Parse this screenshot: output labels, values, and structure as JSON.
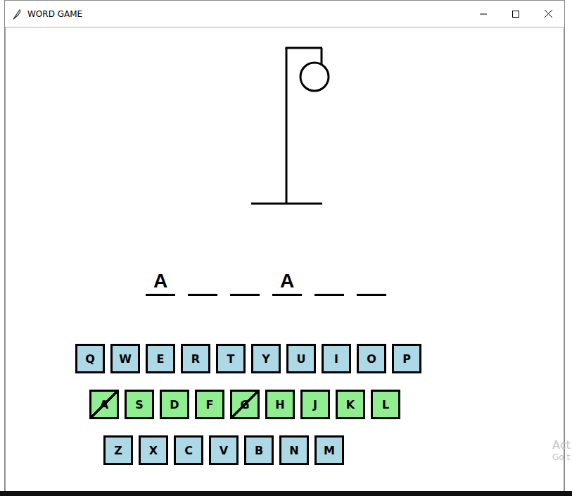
{
  "window": {
    "title": "WORD GAME"
  },
  "gallows": {
    "wrong_guesses": 1
  },
  "word": {
    "slots": [
      "A",
      "",
      "",
      "A",
      "",
      ""
    ]
  },
  "keyboard": {
    "rows": [
      {
        "color": "#add8e6",
        "keys": [
          {
            "label": "Q",
            "used": false
          },
          {
            "label": "W",
            "used": false
          },
          {
            "label": "E",
            "used": false
          },
          {
            "label": "R",
            "used": false
          },
          {
            "label": "T",
            "used": false
          },
          {
            "label": "Y",
            "used": false
          },
          {
            "label": "U",
            "used": false
          },
          {
            "label": "I",
            "used": false
          },
          {
            "label": "O",
            "used": false
          },
          {
            "label": "P",
            "used": false
          }
        ]
      },
      {
        "color": "#90ee90",
        "keys": [
          {
            "label": "A",
            "used": true
          },
          {
            "label": "S",
            "used": false
          },
          {
            "label": "D",
            "used": false
          },
          {
            "label": "F",
            "used": false
          },
          {
            "label": "G",
            "used": true
          },
          {
            "label": "H",
            "used": false
          },
          {
            "label": "J",
            "used": false
          },
          {
            "label": "K",
            "used": false
          },
          {
            "label": "L",
            "used": false
          }
        ]
      },
      {
        "color": "#add8e6",
        "keys": [
          {
            "label": "Z",
            "used": false
          },
          {
            "label": "X",
            "used": false
          },
          {
            "label": "C",
            "used": false
          },
          {
            "label": "V",
            "used": false
          },
          {
            "label": "B",
            "used": false
          },
          {
            "label": "N",
            "used": false
          },
          {
            "label": "M",
            "used": false
          }
        ]
      }
    ]
  },
  "watermark": [
    "Act",
    "Go t"
  ]
}
